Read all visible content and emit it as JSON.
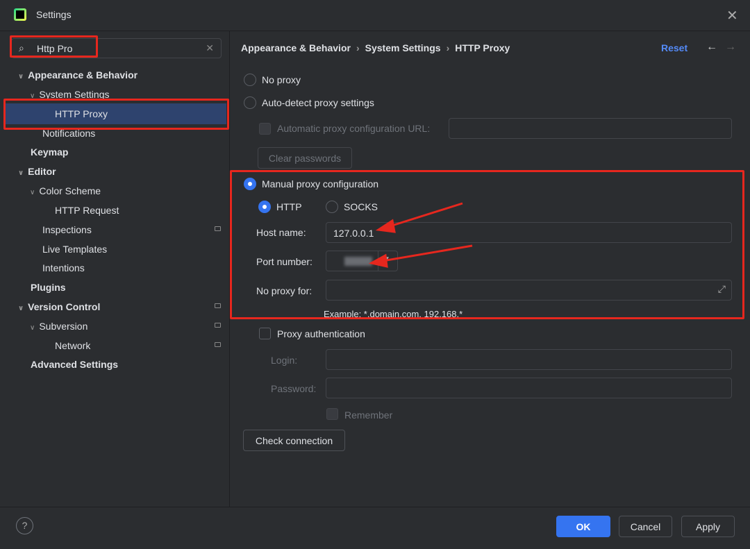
{
  "window": {
    "title": "Settings",
    "close_icon": "close-icon"
  },
  "search": {
    "value": "Http Pro"
  },
  "sidebar": {
    "items": [
      {
        "label": "Appearance & Behavior",
        "bold": true
      },
      {
        "label": "System Settings"
      },
      {
        "label": "HTTP Proxy",
        "selected": true
      },
      {
        "label": "Notifications"
      },
      {
        "label": "Keymap",
        "bold": true
      },
      {
        "label": "Editor",
        "bold": true
      },
      {
        "label": "Color Scheme"
      },
      {
        "label": "HTTP Request"
      },
      {
        "label": "Inspections"
      },
      {
        "label": "Live Templates"
      },
      {
        "label": "Intentions"
      },
      {
        "label": "Plugins",
        "bold": true
      },
      {
        "label": "Version Control",
        "bold": true
      },
      {
        "label": "Subversion"
      },
      {
        "label": "Network"
      },
      {
        "label": "Advanced Settings",
        "bold": true
      }
    ]
  },
  "breadcrumb": [
    "Appearance & Behavior",
    "System Settings",
    "HTTP Proxy"
  ],
  "header": {
    "reset": "Reset"
  },
  "proxy": {
    "no_proxy": "No proxy",
    "auto_detect": "Auto-detect proxy settings",
    "auto_url_label": "Automatic proxy configuration URL:",
    "clear_passwords": "Clear passwords",
    "manual": "Manual proxy configuration",
    "http": "HTTP",
    "socks": "SOCKS",
    "host_label": "Host name:",
    "host_value": "127.0.0.1",
    "port_label": "Port number:",
    "no_proxy_for_label": "No proxy for:",
    "example": "Example: *.domain.com, 192.168.*",
    "proxy_auth": "Proxy authentication",
    "login_label": "Login:",
    "password_label": "Password:",
    "remember": "Remember",
    "check_connection": "Check connection"
  },
  "footer": {
    "ok": "OK",
    "cancel": "Cancel",
    "apply": "Apply",
    "help": "?"
  },
  "colors": {
    "accent": "#3574f0",
    "annotation": "#e6271e",
    "selection": "#2e436e"
  }
}
